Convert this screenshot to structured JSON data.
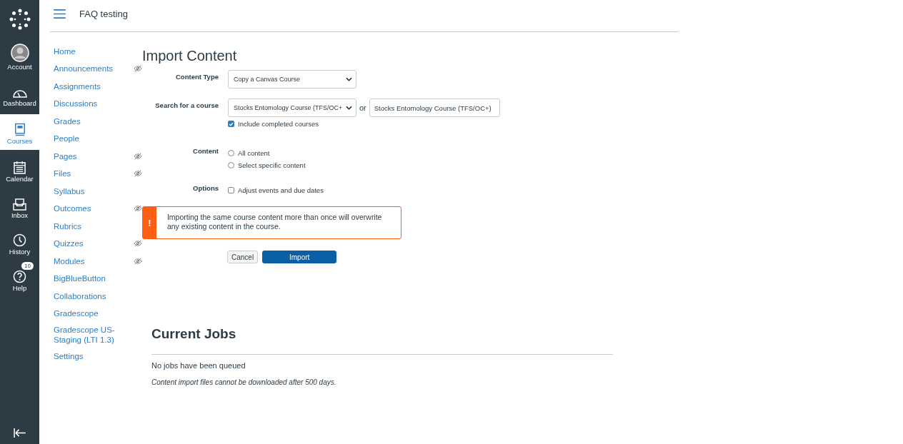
{
  "global_nav": [
    {
      "label": "Account",
      "kind": "account",
      "selected": false
    },
    {
      "label": "Dashboard",
      "kind": "dashboard",
      "selected": false
    },
    {
      "label": "Courses",
      "kind": "courses",
      "selected": true
    },
    {
      "label": "Calendar",
      "kind": "calendar",
      "selected": false
    },
    {
      "label": "Inbox",
      "kind": "inbox",
      "selected": false
    },
    {
      "label": "History",
      "kind": "history",
      "selected": false
    },
    {
      "label": "Help",
      "kind": "help",
      "selected": false,
      "badge": "10"
    }
  ],
  "header": {
    "title": "FAQ testing"
  },
  "course_nav": [
    {
      "label": "Home",
      "hidden": false
    },
    {
      "label": "Announcements",
      "hidden": true
    },
    {
      "label": "Assignments",
      "hidden": false
    },
    {
      "label": "Discussions",
      "hidden": false
    },
    {
      "label": "Grades",
      "hidden": false
    },
    {
      "label": "People",
      "hidden": false
    },
    {
      "label": "Pages",
      "hidden": true
    },
    {
      "label": "Files",
      "hidden": true
    },
    {
      "label": "Syllabus",
      "hidden": false
    },
    {
      "label": "Outcomes",
      "hidden": true
    },
    {
      "label": "Rubrics",
      "hidden": false
    },
    {
      "label": "Quizzes",
      "hidden": true
    },
    {
      "label": "Modules",
      "hidden": true
    },
    {
      "label": "BigBlueButton",
      "hidden": false
    },
    {
      "label": "Collaborations",
      "hidden": false
    },
    {
      "label": "Gradescope",
      "hidden": false
    },
    {
      "label": "Gradescope US-Staging (LTI 1.3)",
      "hidden": false
    },
    {
      "label": "Settings",
      "hidden": false
    }
  ],
  "import": {
    "title": "Import Content",
    "content_type": {
      "label": "Content Type",
      "value": "Copy a Canvas Course"
    },
    "search": {
      "label": "Search for a course",
      "select_value": "Stocks Entomology Course (TFS/OC+",
      "or": "or",
      "input_value": "Stocks Entomology Course (TFS/OC+)",
      "include_completed": {
        "label": "Include completed courses",
        "checked": true
      }
    },
    "content": {
      "label": "Content",
      "options": [
        {
          "label": "All content",
          "selected": false
        },
        {
          "label": "Select specific content",
          "selected": false
        }
      ]
    },
    "options": {
      "label": "Options",
      "items": [
        {
          "label": "Adjust events and due dates",
          "checked": false
        }
      ]
    },
    "warning": {
      "icon": "!",
      "text": "Importing the same course content more than once will overwrite any existing content in the course."
    },
    "buttons": {
      "cancel": "Cancel",
      "import": "Import"
    }
  },
  "jobs": {
    "title": "Current Jobs",
    "empty": "No jobs have been queued",
    "note": "Content import files cannot be downloaded after 500 days."
  }
}
